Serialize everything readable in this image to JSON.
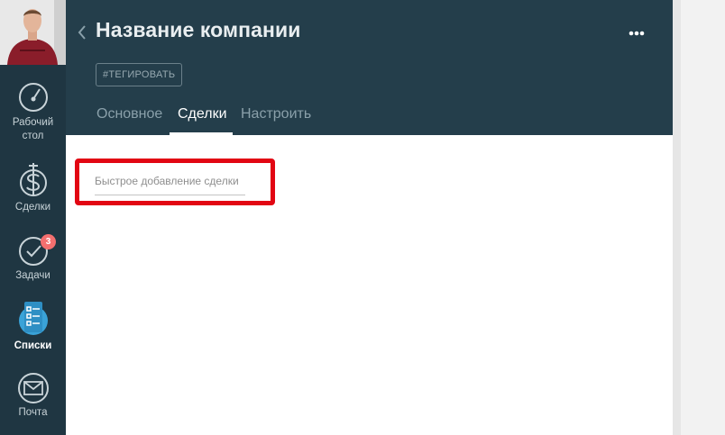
{
  "sidebar": {
    "items": [
      {
        "label": "Рабочий стол",
        "line1": "Рабочий",
        "line2": "стол",
        "icon": "dashboard-gauge-icon"
      },
      {
        "label": "Сделки",
        "icon": "dollar-icon"
      },
      {
        "label": "Задачи",
        "icon": "check-circle-icon",
        "badge": "3"
      },
      {
        "label": "Списки",
        "icon": "list-icon",
        "active": true
      },
      {
        "label": "Почта",
        "icon": "mail-icon"
      }
    ]
  },
  "header": {
    "title": "Название компании",
    "tag_button": "#ТЕГИРОВАТЬ",
    "more_icon": "more-dots-icon",
    "back_icon": "chevron-left-icon",
    "tabs": [
      {
        "label": "Основное"
      },
      {
        "label": "Сделки",
        "active": true
      },
      {
        "label": "Настроить"
      }
    ]
  },
  "main": {
    "quick_add_placeholder": "Быстрое добавление сделки"
  },
  "colors": {
    "sidebar_bg": "#1f3642",
    "header_bg": "#243e4b",
    "highlight": "#e20613",
    "badge": "#f36f6f",
    "active_icon": "#3aa3d8"
  }
}
